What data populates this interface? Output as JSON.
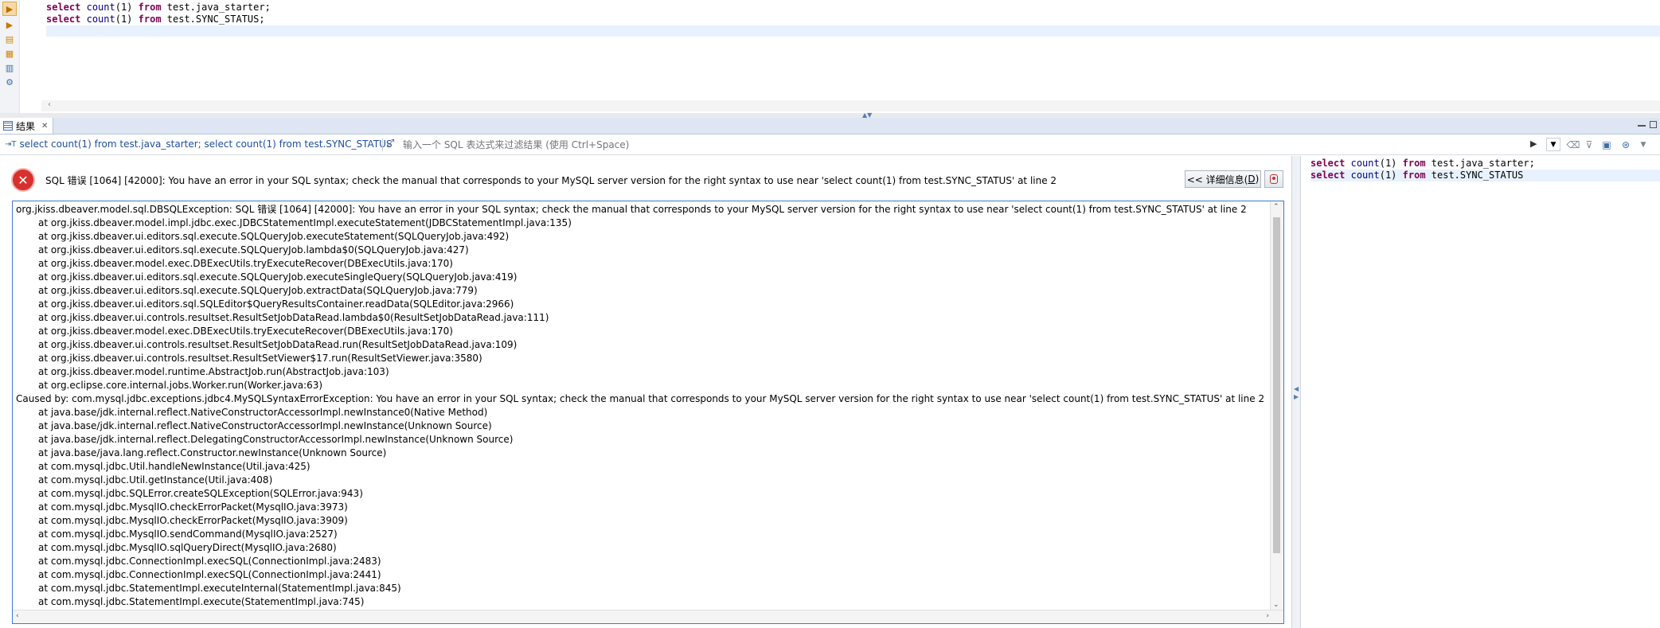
{
  "editor": {
    "lines": [
      {
        "kw1": "select",
        "fn": "count",
        "arg": "(1)",
        "kw2": "from",
        "table": "test.java_starter;"
      },
      {
        "kw1": "select",
        "fn": "count",
        "arg": "(1)",
        "kw2": "from",
        "table": "test.SYNC_STATUS;"
      }
    ],
    "gutter_icons": [
      "execute-statement-icon",
      "execute-script-icon",
      "explain-plan-icon",
      "load-plan-icon",
      "export-icon",
      "settings-icon"
    ]
  },
  "results": {
    "tab_label": "结果",
    "filter_query": "select count(1) from test.java_starter; select count(1) from test.SYNC_STATUS",
    "filter_placeholder": "输入一个 SQL 表达式来过滤结果 (使用 Ctrl+Space)"
  },
  "error": {
    "title": "SQL 错误 [1064] [42000]: You have an error in your SQL syntax; check the manual that corresponds to your MySQL server version for the right syntax to use near 'select count(1) from test.SYNC_STATUS' at line 2",
    "details_label": "<< 详细信息(",
    "details_mnemonic": "D",
    "details_suffix": ")",
    "accent_color": "#d8312d"
  },
  "stack_trace": [
    {
      "indent": false,
      "text": "org.jkiss.dbeaver.model.sql.DBSQLException: SQL 错误 [1064] [42000]: You have an error in your SQL syntax; check the manual that corresponds to your MySQL server version for the right syntax to use near 'select count(1) from test.SYNC_STATUS' at line 2"
    },
    {
      "indent": true,
      "text": "at org.jkiss.dbeaver.model.impl.jdbc.exec.JDBCStatementImpl.executeStatement(JDBCStatementImpl.java:135)"
    },
    {
      "indent": true,
      "text": "at org.jkiss.dbeaver.ui.editors.sql.execute.SQLQueryJob.executeStatement(SQLQueryJob.java:492)"
    },
    {
      "indent": true,
      "text": "at org.jkiss.dbeaver.ui.editors.sql.execute.SQLQueryJob.lambda$0(SQLQueryJob.java:427)"
    },
    {
      "indent": true,
      "text": "at org.jkiss.dbeaver.model.exec.DBExecUtils.tryExecuteRecover(DBExecUtils.java:170)"
    },
    {
      "indent": true,
      "text": "at org.jkiss.dbeaver.ui.editors.sql.execute.SQLQueryJob.executeSingleQuery(SQLQueryJob.java:419)"
    },
    {
      "indent": true,
      "text": "at org.jkiss.dbeaver.ui.editors.sql.execute.SQLQueryJob.extractData(SQLQueryJob.java:779)"
    },
    {
      "indent": true,
      "text": "at org.jkiss.dbeaver.ui.editors.sql.SQLEditor$QueryResultsContainer.readData(SQLEditor.java:2966)"
    },
    {
      "indent": true,
      "text": "at org.jkiss.dbeaver.ui.controls.resultset.ResultSetJobDataRead.lambda$0(ResultSetJobDataRead.java:111)"
    },
    {
      "indent": true,
      "text": "at org.jkiss.dbeaver.model.exec.DBExecUtils.tryExecuteRecover(DBExecUtils.java:170)"
    },
    {
      "indent": true,
      "text": "at org.jkiss.dbeaver.ui.controls.resultset.ResultSetJobDataRead.run(ResultSetJobDataRead.java:109)"
    },
    {
      "indent": true,
      "text": "at org.jkiss.dbeaver.ui.controls.resultset.ResultSetViewer$17.run(ResultSetViewer.java:3580)"
    },
    {
      "indent": true,
      "text": "at org.jkiss.dbeaver.model.runtime.AbstractJob.run(AbstractJob.java:103)"
    },
    {
      "indent": true,
      "text": "at org.eclipse.core.internal.jobs.Worker.run(Worker.java:63)"
    },
    {
      "indent": false,
      "text": "Caused by: com.mysql.jdbc.exceptions.jdbc4.MySQLSyntaxErrorException: You have an error in your SQL syntax; check the manual that corresponds to your MySQL server version for the right syntax to use near 'select count(1) from test.SYNC_STATUS' at line 2"
    },
    {
      "indent": true,
      "text": "at java.base/jdk.internal.reflect.NativeConstructorAccessorImpl.newInstance0(Native Method)"
    },
    {
      "indent": true,
      "text": "at java.base/jdk.internal.reflect.NativeConstructorAccessorImpl.newInstance(Unknown Source)"
    },
    {
      "indent": true,
      "text": "at java.base/jdk.internal.reflect.DelegatingConstructorAccessorImpl.newInstance(Unknown Source)"
    },
    {
      "indent": true,
      "text": "at java.base/java.lang.reflect.Constructor.newInstance(Unknown Source)"
    },
    {
      "indent": true,
      "text": "at com.mysql.jdbc.Util.handleNewInstance(Util.java:425)"
    },
    {
      "indent": true,
      "text": "at com.mysql.jdbc.Util.getInstance(Util.java:408)"
    },
    {
      "indent": true,
      "text": "at com.mysql.jdbc.SQLError.createSQLException(SQLError.java:943)"
    },
    {
      "indent": true,
      "text": "at com.mysql.jdbc.MysqlIO.checkErrorPacket(MysqlIO.java:3973)"
    },
    {
      "indent": true,
      "text": "at com.mysql.jdbc.MysqlIO.checkErrorPacket(MysqlIO.java:3909)"
    },
    {
      "indent": true,
      "text": "at com.mysql.jdbc.MysqlIO.sendCommand(MysqlIO.java:2527)"
    },
    {
      "indent": true,
      "text": "at com.mysql.jdbc.MysqlIO.sqlQueryDirect(MysqlIO.java:2680)"
    },
    {
      "indent": true,
      "text": "at com.mysql.jdbc.ConnectionImpl.execSQL(ConnectionImpl.java:2483)"
    },
    {
      "indent": true,
      "text": "at com.mysql.jdbc.ConnectionImpl.execSQL(ConnectionImpl.java:2441)"
    },
    {
      "indent": true,
      "text": "at com.mysql.jdbc.StatementImpl.executeInternal(StatementImpl.java:845)"
    },
    {
      "indent": true,
      "text": "at com.mysql.jdbc.StatementImpl.execute(StatementImpl.java:745)"
    }
  ],
  "query_panel": {
    "lines": [
      {
        "kw1": "select",
        "fn": "count",
        "arg": "(1)",
        "kw2": "from",
        "table": "test.java_starter;"
      },
      {
        "kw1": "select",
        "fn": "count",
        "arg": "(1)",
        "kw2": "from",
        "table": "test.SYNC_STATUS"
      }
    ]
  }
}
